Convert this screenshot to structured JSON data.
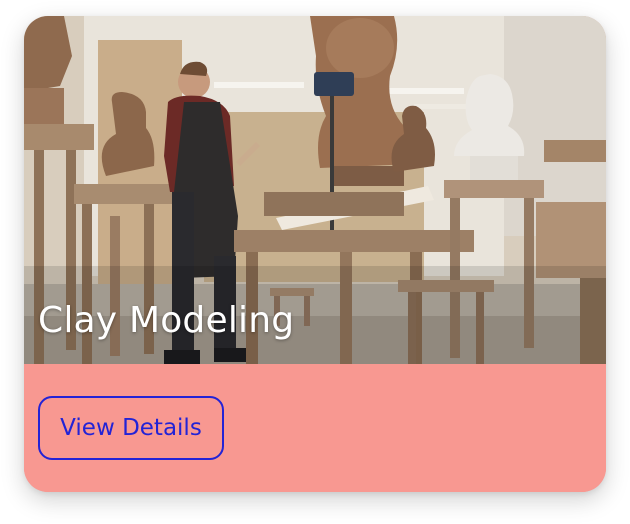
{
  "card": {
    "title": "Clay Modeling",
    "button_label": "View Details",
    "image_alt": "sculptor-studio-photo"
  },
  "colors": {
    "footer_bg": "#f89891",
    "button_text": "#2323d6",
    "button_border": "#2323d6",
    "title_text": "#ffffff"
  }
}
